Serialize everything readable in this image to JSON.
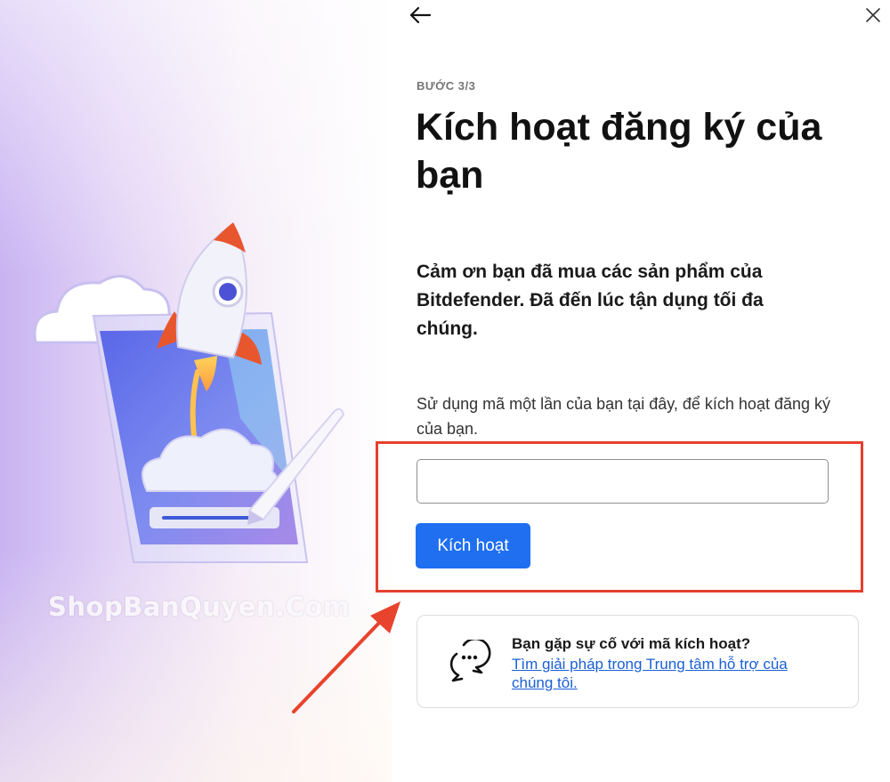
{
  "nav": {
    "back_label": "Back",
    "close_label": "Close",
    "back_icon": "arrow-left-icon",
    "close_icon": "close-icon"
  },
  "step_label": "BƯỚC 3/3",
  "title": "Kích hoạt đăng ký của bạn",
  "lead_text": "Cảm ơn bạn đã mua các sản phẩm của Bitdefender. Đã đến lúc tận dụng tối đa chúng.",
  "instruction_text": "Sử dụng mã một lần của bạn tại đây, để kích hoạt đăng ký của bạn.",
  "code_input": {
    "value": "",
    "placeholder": ""
  },
  "activate_button_label": "Kích hoạt",
  "help": {
    "title": "Bạn gặp sự cố với mã kích hoạt?",
    "link_text": "Tìm giải pháp trong Trung tâm hỗ trợ của chúng tôi.",
    "icon": "chat-bubbles-icon"
  },
  "watermark_text": "ShopBanQuyen.Com",
  "colors": {
    "primary_button": "#1f6ff0",
    "link": "#1a5fd6",
    "highlight_border": "#e5402f",
    "annotation_arrow": "#e8432c",
    "rocket_fin": "#e8562e"
  }
}
